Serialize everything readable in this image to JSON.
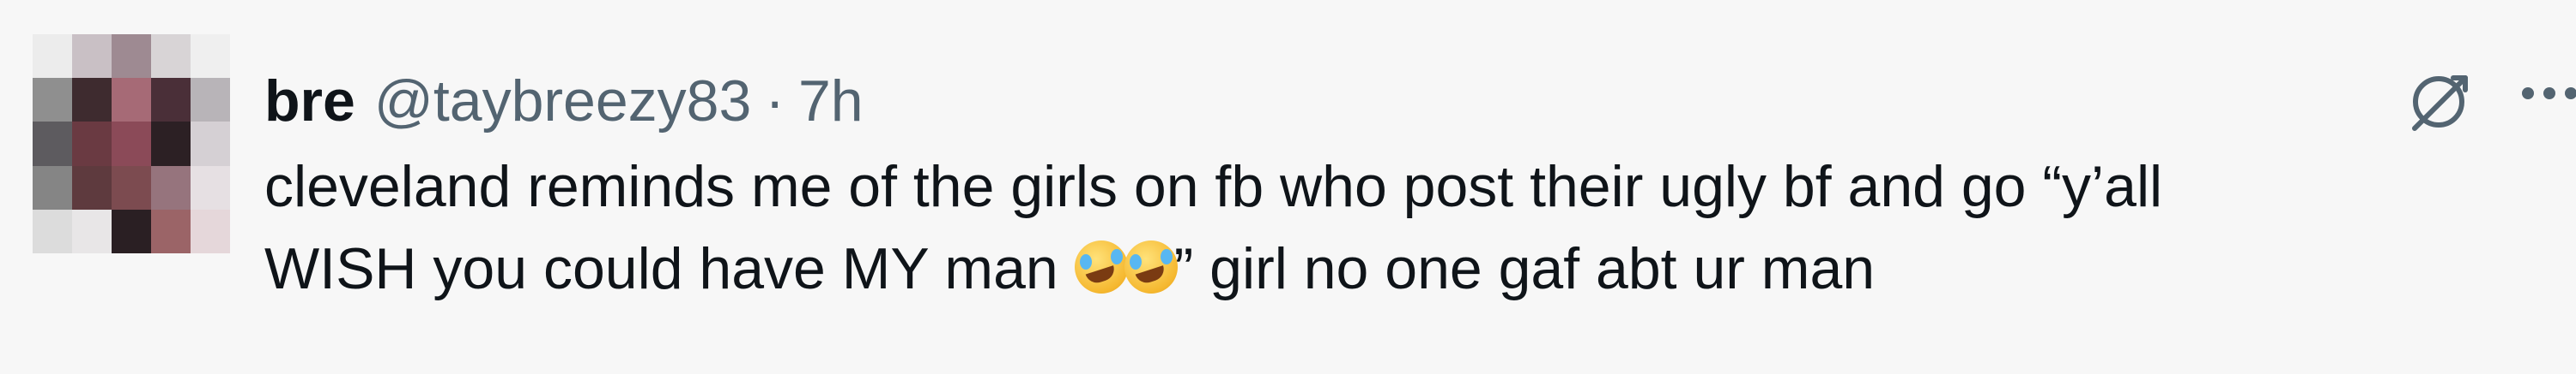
{
  "tweet": {
    "author_name": "bre",
    "author_handle": "@taybreezy83",
    "separator": "·",
    "timestamp": "7h",
    "text_line_1": "cleveland reminds me of the girls on fb who post their ugly bf and go “y’all",
    "text_line_2_before_emoji": "WISH you could have MY man ",
    "text_line_2_after_emoji": "” girl no one gaf abt ur man",
    "emojis": [
      "rolling-on-floor-laughing",
      "rolling-on-floor-laughing"
    ]
  },
  "icons": {
    "grok": "grok-icon",
    "more": "more-options-icon"
  },
  "colors": {
    "background": "#f7f7f7",
    "primary_text": "#0f1419",
    "secondary_text": "#536471"
  },
  "avatar_tiles": [
    "#ececec",
    "#c9c0c5",
    "#9e8a92",
    "#d8d4d6",
    "#efefef",
    "#8f8f8f",
    "#3e2b2f",
    "#a66a76",
    "#4a2f38",
    "#b8b4b8",
    "#5d5b5f",
    "#6a3a42",
    "#8b4a58",
    "#2c2024",
    "#d5d0d4",
    "#858585",
    "#5e3a3e",
    "#7c4b50",
    "#96747d",
    "#e6e0e3",
    "#dcdcdc",
    "#e8e6e7",
    "#2a1f23",
    "#9b6467",
    "#e5d7da"
  ]
}
